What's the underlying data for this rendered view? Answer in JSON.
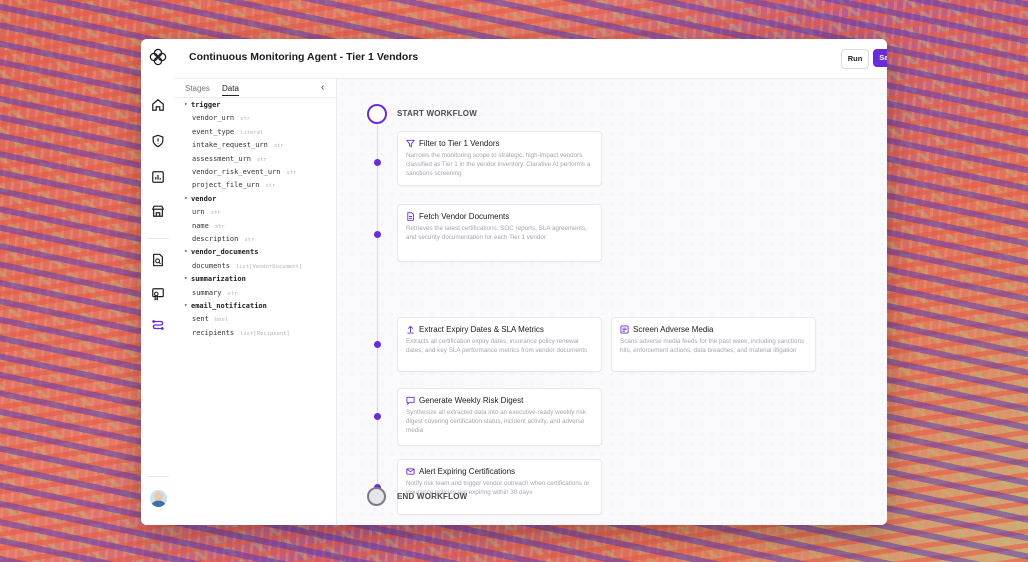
{
  "header": {
    "title": "Continuous Monitoring Agent - Tier 1 Vendors",
    "run_label": "Run",
    "save_label": "Save"
  },
  "panel": {
    "tabs": [
      "Stages",
      "Data"
    ],
    "active_tab": "Data",
    "tree": [
      {
        "name": "trigger",
        "children": [
          {
            "name": "vendor_urn",
            "type": "str"
          },
          {
            "name": "event_type",
            "type": "literal"
          },
          {
            "name": "intake_request_urn",
            "type": "str"
          },
          {
            "name": "assessment_urn",
            "type": "str"
          },
          {
            "name": "vendor_risk_event_urn",
            "type": "str"
          },
          {
            "name": "project_file_urn",
            "type": "str"
          }
        ]
      },
      {
        "name": "vendor",
        "children": [
          {
            "name": "urn",
            "type": "str"
          },
          {
            "name": "name",
            "type": "str"
          },
          {
            "name": "description",
            "type": "str"
          }
        ]
      },
      {
        "name": "vendor_documents",
        "children": [
          {
            "name": "documents",
            "type": "list[VendorDocument]"
          }
        ]
      },
      {
        "name": "summarization",
        "children": [
          {
            "name": "summary",
            "type": "str"
          }
        ]
      },
      {
        "name": "email_notification",
        "children": [
          {
            "name": "sent",
            "type": "bool"
          },
          {
            "name": "recipients",
            "type": "list[Recipient]"
          }
        ]
      }
    ]
  },
  "workflow": {
    "start_label": "START WORKFLOW",
    "end_label": "END WORKFLOW",
    "steps": [
      {
        "title": "Filter to Tier 1 Vendors",
        "icon": "filter-icon",
        "description": "Narrows the monitoring scope to strategic, high-impact vendors classified as Tier 1 in the vendor inventory. Clarative AI performs a sanctions screening"
      },
      {
        "title": "Fetch Vendor Documents",
        "icon": "document-icon",
        "description": "Retrieves the latest certifications, SOC reports, SLA agreements, and security documentation for each Tier 1 vendor"
      },
      {
        "title": "Extract Expiry Dates & SLA Metrics",
        "icon": "upload-icon",
        "description": "Extracts all certification expiry dates, insurance policy renewal dates, and key SLA performance metrics from vendor documents"
      },
      {
        "title": "Screen Adverse Media",
        "icon": "newspaper-icon",
        "description": "Scans adverse media feeds for the past week, including sanctions hits, enforcement actions, data breaches, and material litigation"
      },
      {
        "title": "Generate Weekly Risk Digest",
        "icon": "message-icon",
        "description": "Synthesize all extracted data into an executive-ready weekly risk digest covering certification status, incident activity, and adverse media"
      },
      {
        "title": "Alert Expiring Certifications",
        "icon": "mail-icon",
        "description": "Notify risk team and trigger vendor outreach when certifications or insurance policies are expiring within 30 days"
      }
    ]
  },
  "colors": {
    "accent": "#6a2bd9",
    "muted_text": "#a5a5b0"
  }
}
